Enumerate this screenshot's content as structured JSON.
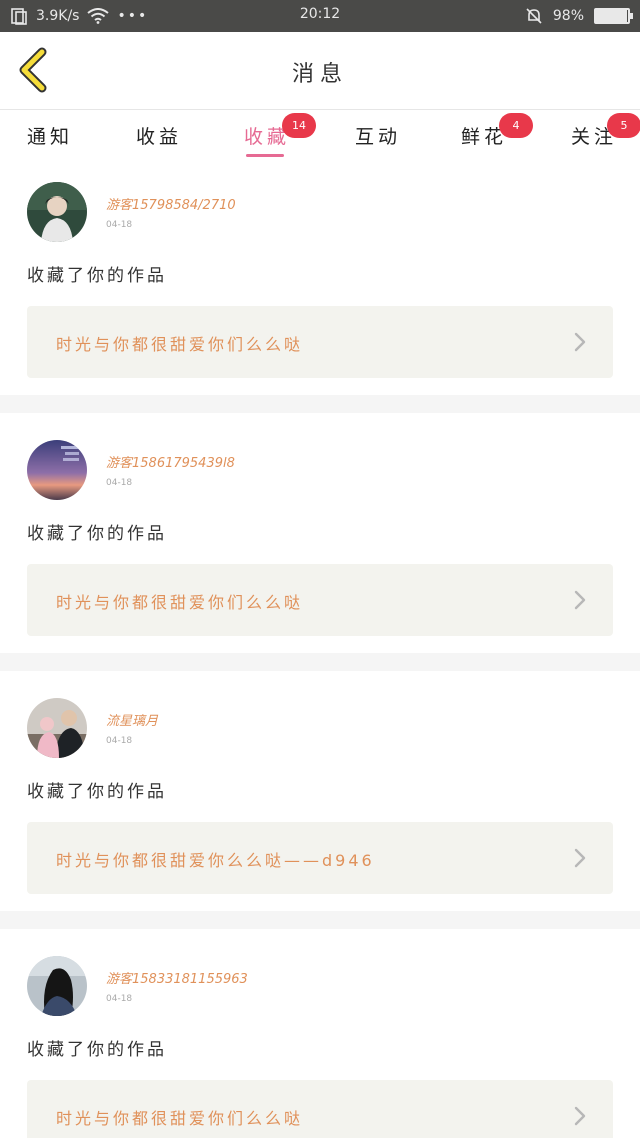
{
  "status_bar": {
    "net_speed": "3.9K/s",
    "time": "20:12",
    "battery_pct": "98%",
    "battery_level": 0.98,
    "icons": [
      "notification-icon",
      "wifi-icon",
      "more-dots-icon",
      "mute-bell-icon",
      "battery-icon"
    ]
  },
  "header": {
    "title": "消息",
    "back_icon": "back-chevron-icon"
  },
  "tabs": [
    {
      "label": "通知",
      "badge": ""
    },
    {
      "label": "收益",
      "badge": ""
    },
    {
      "label": "收藏",
      "badge": "14",
      "active": true
    },
    {
      "label": "互动",
      "badge": ""
    },
    {
      "label": "鲜花",
      "badge": "4"
    },
    {
      "label": "关注",
      "badge": "5"
    }
  ],
  "colors": {
    "accent": "#e66a93",
    "badge": "#e8384a",
    "name": "#e0915a"
  },
  "items": [
    {
      "user": "游客15798584/2710",
      "date": "04-18",
      "action": "收藏了你的作品",
      "work": "时光与你都很甜爱你们么么哒"
    },
    {
      "user": "游客15861795439l8",
      "date": "04-18",
      "action": "收藏了你的作品",
      "work": "时光与你都很甜爱你们么么哒"
    },
    {
      "user": "流星璃月",
      "date": "04-18",
      "action": "收藏了你的作品",
      "work": "时光与你都很甜爱你么么哒——d946"
    },
    {
      "user": "游客15833181155963",
      "date": "04-18",
      "action": "收藏了你的作品",
      "work": "时光与你都很甜爱你们么么哒"
    }
  ]
}
